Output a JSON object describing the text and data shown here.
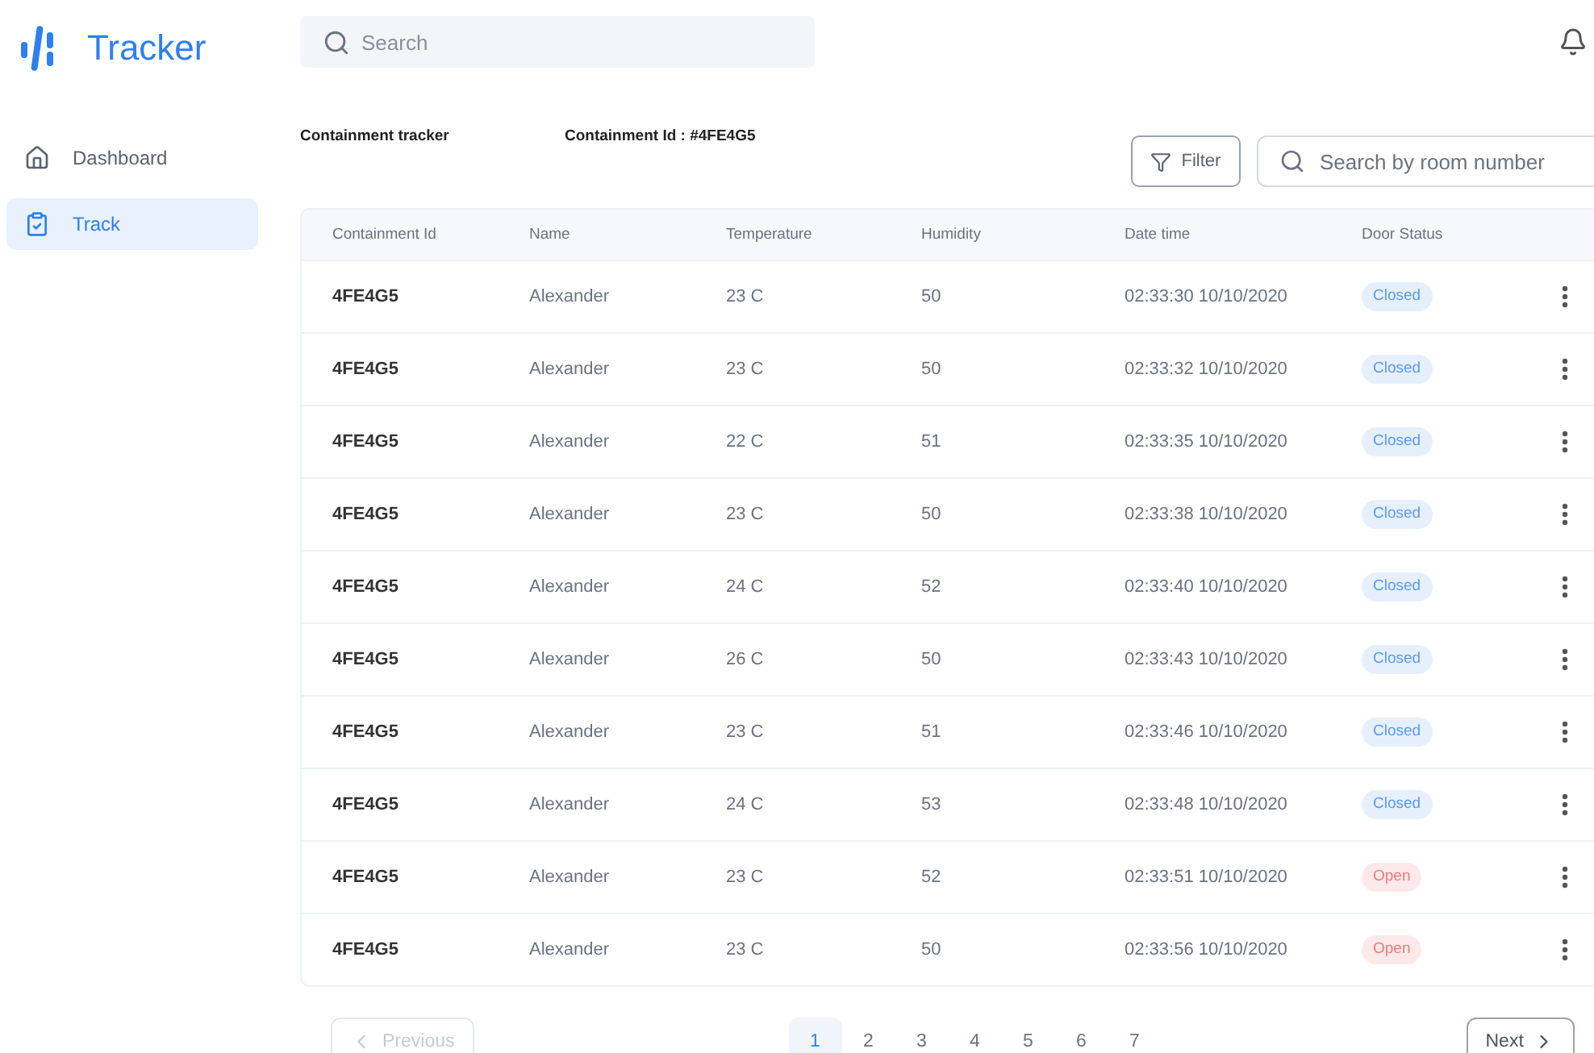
{
  "app": {
    "name": "Tracker"
  },
  "sidebar": {
    "items": [
      {
        "label": "Dashboard",
        "selected": false
      },
      {
        "label": "Track",
        "selected": true
      }
    ]
  },
  "topbar": {
    "search": {
      "placeholder": "Search"
    }
  },
  "heading": {
    "title": "Containment tracker",
    "containment_id": "Containment Id : #4FE4G5"
  },
  "toolbar": {
    "filter_label": "Filter",
    "search": {
      "placeholder": "Search by room number"
    }
  },
  "table": {
    "columns": [
      "Containment Id",
      "Name",
      "Temperature",
      "Humidity",
      "Date time",
      "Door Status"
    ],
    "rows": [
      {
        "id": "4FE4G5",
        "name": "Alexander",
        "temperature": "23 C",
        "humidity": "50",
        "datetime": "02:33:30 10/10/2020",
        "status": {
          "label": "Closed",
          "kind": "closed"
        }
      },
      {
        "id": "4FE4G5",
        "name": "Alexander",
        "temperature": "23 C",
        "humidity": "50",
        "datetime": "02:33:32 10/10/2020",
        "status": {
          "label": "Closed",
          "kind": "closed"
        }
      },
      {
        "id": "4FE4G5",
        "name": "Alexander",
        "temperature": "22 C",
        "humidity": "51",
        "datetime": "02:33:35 10/10/2020",
        "status": {
          "label": "Closed",
          "kind": "closed"
        }
      },
      {
        "id": "4FE4G5",
        "name": "Alexander",
        "temperature": "23 C",
        "humidity": "50",
        "datetime": "02:33:38 10/10/2020",
        "status": {
          "label": "Closed",
          "kind": "closed"
        }
      },
      {
        "id": "4FE4G5",
        "name": "Alexander",
        "temperature": "24 C",
        "humidity": "52",
        "datetime": "02:33:40 10/10/2020",
        "status": {
          "label": "Closed",
          "kind": "closed"
        }
      },
      {
        "id": "4FE4G5",
        "name": "Alexander",
        "temperature": "26 C",
        "humidity": "50",
        "datetime": "02:33:43 10/10/2020",
        "status": {
          "label": "Closed",
          "kind": "closed"
        }
      },
      {
        "id": "4FE4G5",
        "name": "Alexander",
        "temperature": "23 C",
        "humidity": "51",
        "datetime": "02:33:46 10/10/2020",
        "status": {
          "label": "Closed",
          "kind": "closed"
        }
      },
      {
        "id": "4FE4G5",
        "name": "Alexander",
        "temperature": "24 C",
        "humidity": "53",
        "datetime": "02:33:48 10/10/2020",
        "status": {
          "label": "Closed",
          "kind": "closed"
        }
      },
      {
        "id": "4FE4G5",
        "name": "Alexander",
        "temperature": "23 C",
        "humidity": "52",
        "datetime": "02:33:51 10/10/2020",
        "status": {
          "label": "Open",
          "kind": "open"
        }
      },
      {
        "id": "4FE4G5",
        "name": "Alexander",
        "temperature": "23 C",
        "humidity": "50",
        "datetime": "02:33:56 10/10/2020",
        "status": {
          "label": "Open",
          "kind": "open"
        }
      }
    ]
  },
  "pagination": {
    "previous": {
      "label": "Previous",
      "disabled": true
    },
    "next": {
      "label": "Next",
      "disabled": false
    },
    "pages": [
      {
        "label": "1",
        "selected": true
      },
      {
        "label": "2",
        "selected": false
      },
      {
        "label": "3",
        "selected": false
      },
      {
        "label": "4",
        "selected": false
      },
      {
        "label": "5",
        "selected": false
      },
      {
        "label": "6",
        "selected": false
      },
      {
        "label": "7",
        "selected": false
      }
    ]
  }
}
